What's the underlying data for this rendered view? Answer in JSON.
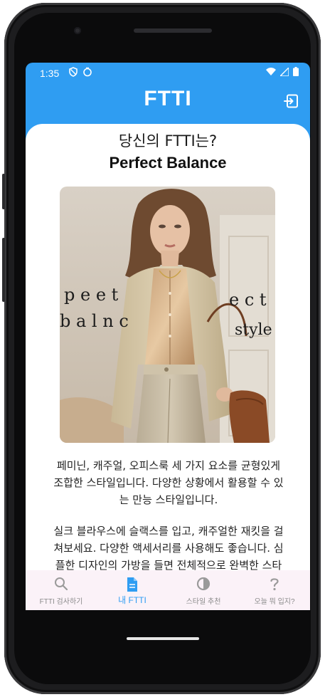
{
  "status_bar": {
    "time": "1:35"
  },
  "app_bar": {
    "title": "FTTI",
    "logout_icon": "logout-icon"
  },
  "result": {
    "question": "당신의 FTTI는?",
    "type_name": "Perfect Balance",
    "image_caption_left": [
      "p e e t",
      "b a l n c"
    ],
    "image_caption_right": [
      "e c t",
      "style"
    ],
    "description": "페미닌, 캐주얼, 오피스룩 세 가지 요소를 균형있게 조합한 스타일입니다. 다양한 상황에서 활용할 수 있는 만능 스타일입니다.",
    "tip": "실크 블라우스에 슬랙스를 입고, 캐주얼한 재킷을 걸쳐보세요. 다양한 액세서리를 사용해도 좋습니다. 심플한 디자인의 가방을 들면 전체적으로 완벽한 스타일을 연출할 수 있습니다."
  },
  "bottom_nav": {
    "items": [
      {
        "label": "FTTI 검사하기",
        "icon": "search-icon",
        "active": false
      },
      {
        "label": "내 FTTI",
        "icon": "document-icon",
        "active": true
      },
      {
        "label": "스타일 추천",
        "icon": "contrast-icon",
        "active": false
      },
      {
        "label": "오늘 뭐 입지?",
        "icon": "question-icon",
        "active": false
      }
    ]
  },
  "colors": {
    "primary": "#2F9DF2",
    "nav_background": "#FBF2F8",
    "text": "#222222"
  }
}
